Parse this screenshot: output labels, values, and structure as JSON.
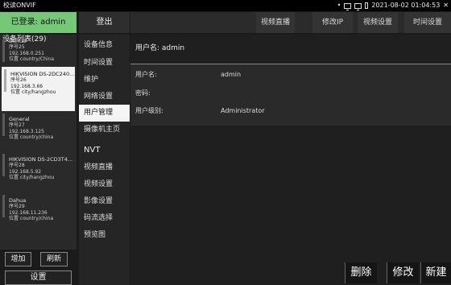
{
  "titlebar": {
    "title": "校读ONVIF",
    "status": "• ",
    "datetime": "2021-08-02 01:04:53",
    "close": "✕"
  },
  "header": {
    "login_status": "已登录: admin",
    "logout_label": "登出",
    "tabs": [
      "视频直播",
      "修改IP",
      "视频设置",
      "时间设置"
    ]
  },
  "devices": {
    "title": "设备列表(29)",
    "items": [
      {
        "name": "Dahua",
        "serial": "序号25",
        "ip": "192.168.0.251",
        "location": "位置 country/China"
      },
      {
        "name": "HIKVISION DS-2DC240...",
        "serial": "序号26",
        "ip": "192.168.3.66",
        "location": "位置 city/hangzhou"
      },
      {
        "name": "General",
        "serial": "序号27",
        "ip": "192.168.3.125",
        "location": "位置 country/china"
      },
      {
        "name": "HIKVISION DS-2CD3T4...",
        "serial": "序号28",
        "ip": "192.168.5.92",
        "location": "位置 city/hangzhou"
      },
      {
        "name": "Dahua",
        "serial": "序号29",
        "ip": "192.168.11.236",
        "location": "位置 country/china"
      }
    ],
    "add_label": "增加",
    "refresh_label": "刷新",
    "settings_label": "设置"
  },
  "menu": {
    "items": [
      "设备信息",
      "时间设置",
      "维护",
      "网络设置",
      "用户管理",
      "摄像机主页"
    ],
    "section": "NVT",
    "nvt_items": [
      "视频直播",
      "视频设置",
      "影像设置",
      "码流选择",
      "预览图"
    ]
  },
  "content": {
    "username_header": "用户名: admin",
    "labels": [
      "用户名:",
      "密码:",
      "用户级别:"
    ],
    "values": [
      "admin",
      "",
      "Administrator"
    ],
    "delete_label": "删除",
    "modify_label": "修改",
    "new_label": "新建"
  },
  "colors": {
    "login_bg": "#76c878",
    "selected_bg": "#f5f5f5"
  }
}
